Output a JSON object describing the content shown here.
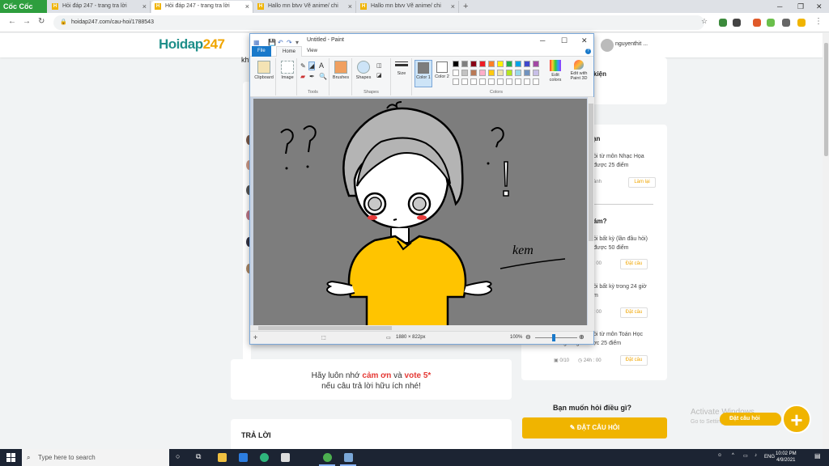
{
  "browser": {
    "brand": "Cốc Cốc",
    "tabs": [
      {
        "label": "Hỏi đáp 247 - trang tra lời"
      },
      {
        "label": "Hỏi đáp 247 - trang tra lời"
      },
      {
        "label": "Hallo mn btvv Vẽ anime/ chi"
      },
      {
        "label": "Hallo mn btvv Vẽ anime/ chi"
      }
    ],
    "new_tab": "+",
    "url": "hoidap247.com/cau-hoi/1788543"
  },
  "site": {
    "logo_main": "Hoidap",
    "logo_accent": "247",
    "username": "nguyenthit ...",
    "left_partial_text": "kh",
    "reminder": {
      "line1_prefix": "Hãy luôn nhớ ",
      "thanks": "cảm ơn",
      "and": " và ",
      "vote": "vote 5*",
      "line2": "nếu câu trả lời hữu ích nhé!"
    },
    "answer_title": "TRẢ LỜI",
    "right_panel": {
      "card1_title": "kiện",
      "card2_title": "ạn",
      "item1_line1": "ỏi  từ môn Nhạc Họa",
      "item1_line2": "được 25 điểm",
      "item1_btn": "Làm lại",
      "item1_meta": "ành",
      "section2_title": "ám?",
      "item2_line1": "ỏi  bất kỳ (lần đầu hỏi)",
      "item2_line2": "được 50 điểm",
      "item2_btn": "Đặt câu",
      "item2_meta": ": 00",
      "item3_line1": "ỏi  bất kỳ  trong 24 giờ",
      "item3_line2": "m",
      "item3_btn": "Đặt câu",
      "item3_meta": ": 00",
      "item4_line1": "ỏi  từ môn Toán Học",
      "item4_line2": "trong 24 giờ được 25 điểm",
      "item4_btn": "Đặt câu",
      "item4_meta_count": "0/10",
      "item4_meta_time": "24h : 00"
    },
    "ask_question": "Bạn muốn hỏi điều gì?",
    "ask_button": "ĐẶT CÂU HỎI",
    "float_ask": "Đặt câu hỏi",
    "float_plus": "+",
    "activate_title": "Activate Windows",
    "activate_sub": "Go to Settings to activate Windows."
  },
  "paint": {
    "title": "Untitled - Paint",
    "tabs": {
      "file": "File",
      "home": "Home",
      "view": "View"
    },
    "help": "?",
    "ribbon": {
      "clipboard": "Clipboard",
      "image": "Image",
      "tools": "Tools",
      "brushes": "Brushes",
      "shapes": "Shapes",
      "shapes_btn": "Shapes",
      "size": "Size",
      "color1": "Color 1",
      "color2": "Color 2",
      "colors": "Colors",
      "edit_colors": "Edit colors",
      "edit_paint3d": "Edit with Paint 3D"
    },
    "palette": [
      "#000000",
      "#7f7f7f",
      "#880015",
      "#ed1c24",
      "#ff7f27",
      "#fff200",
      "#22b14c",
      "#00a2e8",
      "#3f48cc",
      "#a349a4",
      "#ffffff",
      "#c3c3c3",
      "#b97a57",
      "#ffaec9",
      "#ffc90e",
      "#efe4b0",
      "#b5e61d",
      "#99d9ea",
      "#7092be",
      "#c8bfe7"
    ],
    "color1_value": "#7d7d7d",
    "color2_value": "#ffffff",
    "status_size": "1880 × 822px",
    "zoom": "100%",
    "drawing": {
      "bg": "#7d7d7d",
      "hair": "#b4b4b4",
      "shirt": "#ffc400",
      "blush": "#e83a3a",
      "signature": "kem"
    }
  },
  "taskbar": {
    "search_placeholder": "Type here to search",
    "lang": "ENG",
    "time": "10:02 PM",
    "date": "4/9/2021"
  }
}
